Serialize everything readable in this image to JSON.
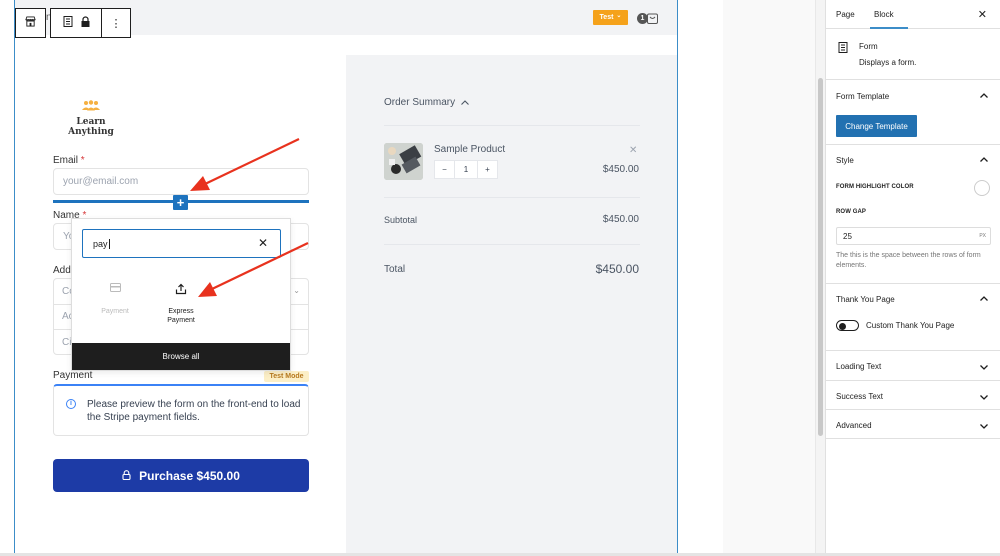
{
  "editor": {
    "block_toolbar": {
      "store_icon": "store-icon",
      "form_icon": "form-icon",
      "lock_icon": "lock-icon",
      "more_icon": "⋮",
      "stray_text": "n"
    },
    "header": {
      "test_button_label": "Test",
      "test_button_chevron": "⌄",
      "cart_count": "1"
    }
  },
  "form": {
    "logo": {
      "line1": "Learn",
      "line2": "Anything"
    },
    "email": {
      "label": "Email",
      "required_mark": "*",
      "placeholder": "your@email.com"
    },
    "name": {
      "label": "Name",
      "required_mark": "*",
      "placeholder_visible": "Yo"
    },
    "address": {
      "label_visible": "Add",
      "rows": [
        {
          "placeholder_visible": "Co",
          "has_dropdown": true
        },
        {
          "placeholder_visible": "Ac"
        },
        {
          "placeholder_visible": "Ci"
        }
      ]
    },
    "payment": {
      "label": "Payment",
      "badge": "Test Mode",
      "notice": "Please preview the form on the front-end to load the Stripe payment fields."
    },
    "purchase_button": "Purchase $450.00",
    "insert_plus": "+"
  },
  "inserter": {
    "search_value": "pay",
    "clear": "✕",
    "results": [
      {
        "label": "Payment",
        "icon": "credit-card-icon",
        "disabled": true
      },
      {
        "label": "Express Payment",
        "icon": "share-upload-icon",
        "disabled": false
      }
    ],
    "browse_all": "Browse all"
  },
  "summary": {
    "title": "Order Summary",
    "product": {
      "name": "Sample Product",
      "quantity": "1",
      "minus": "−",
      "plus": "+",
      "price": "$450.00",
      "remove": "✕"
    },
    "subtotal_label": "Subtotal",
    "subtotal_value": "$450.00",
    "total_label": "Total",
    "total_value": "$450.00"
  },
  "sidebar": {
    "tabs": [
      {
        "label": "Page"
      },
      {
        "label": "Block",
        "active": true
      }
    ],
    "close": "✕",
    "block_card": {
      "title": "Form",
      "description": "Displays a form."
    },
    "panels": {
      "form_template": {
        "title": "Form Template",
        "button": "Change Template",
        "open": true
      },
      "style": {
        "title": "Style",
        "open": true,
        "highlight_label": "FORM HIGHLIGHT COLOR",
        "row_gap_label": "ROW GAP",
        "row_gap_value": "25",
        "row_gap_unit": "PX",
        "help": "The this is the space between the rows of form elements."
      },
      "thank_you": {
        "title": "Thank You Page",
        "open": true,
        "toggle_label": "Custom Thank You Page",
        "toggle_on": false
      },
      "loading_text": {
        "title": "Loading Text",
        "open": false
      },
      "success_text": {
        "title": "Success Text",
        "open": false
      },
      "advanced": {
        "title": "Advanced",
        "open": false
      }
    }
  },
  "colors": {
    "accent_blue": "#2271b1",
    "insert_blue": "#1e73be",
    "purchase_blue": "#1d3ba6",
    "test_orange": "#f5a21b",
    "annotation_red": "#e8321e"
  }
}
